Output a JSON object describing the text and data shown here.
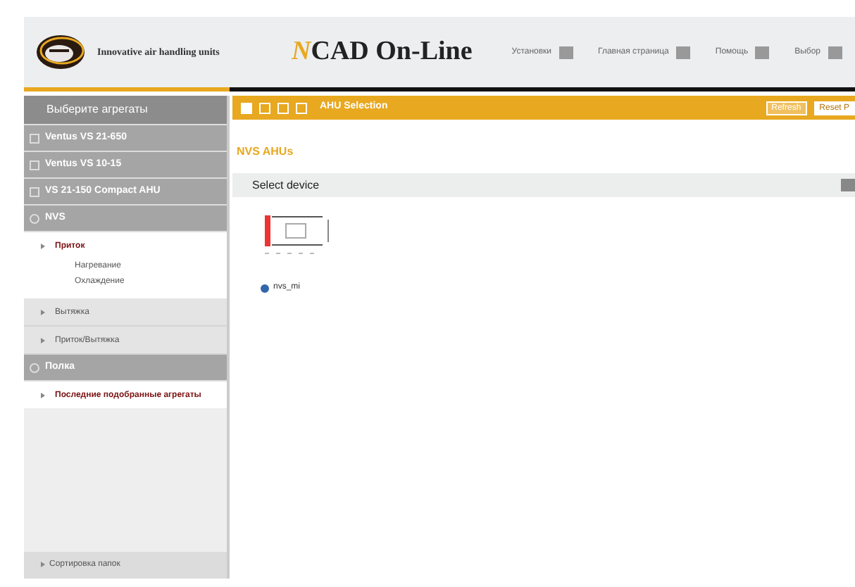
{
  "header": {
    "tagline": "Innovative air handling units",
    "app_title_mark": "N",
    "app_title": "CAD On-Line",
    "links": [
      {
        "label": "Установки"
      },
      {
        "label": "Главная страница"
      },
      {
        "label": "Помощь"
      },
      {
        "label": "Выбор"
      }
    ]
  },
  "sidebar": {
    "title": "Выберите агрегаты",
    "groups": [
      {
        "label": "Ventus VS 21-650",
        "expanded": false
      },
      {
        "label": "Ventus VS 10-15",
        "expanded": false
      },
      {
        "label": "VS 21-150 Compact AHU",
        "expanded": false
      },
      {
        "label": "NVS",
        "expanded": true,
        "children": [
          {
            "label": "Приток",
            "selected": true,
            "children": [
              {
                "label": "Нагревание"
              },
              {
                "label": "Охлаждение"
              }
            ]
          },
          {
            "label": "Вытяжка",
            "selected": false
          },
          {
            "label": "Приток/Вытяжка",
            "selected": false
          }
        ]
      },
      {
        "label": "Полка",
        "expanded": true,
        "children": [
          {
            "label": "Последние подобранные агрегаты",
            "selected": true
          }
        ]
      }
    ],
    "footer": "Сортировка папок"
  },
  "toolbar": {
    "title": "AHU Selection",
    "buttons": [
      "Refresh",
      "Reset P"
    ]
  },
  "section_title": "NVS AHUs",
  "panel": {
    "title": "Select device"
  },
  "devices": [
    {
      "caption": "nvs_mi",
      "selected": true
    }
  ]
}
